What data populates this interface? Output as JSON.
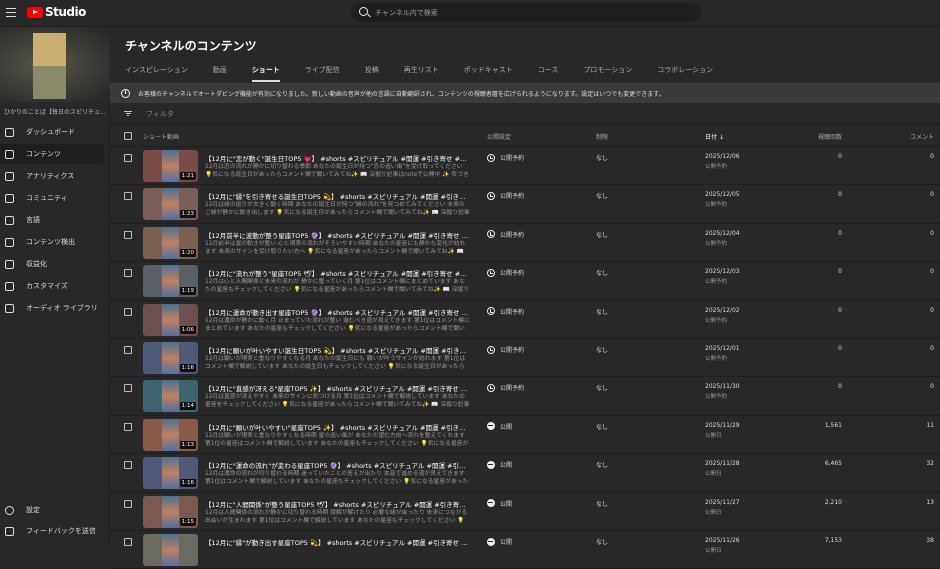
{
  "header": {
    "app": "Studio",
    "search_placeholder": "チャンネル内で検索"
  },
  "sidebar": {
    "channel_name": "ひかりのことば【毎日のスピリチュ...",
    "items": [
      {
        "label": "ダッシュボード",
        "icon": "dashboard-icon"
      },
      {
        "label": "コンテンツ",
        "icon": "content-icon",
        "active": true
      },
      {
        "label": "アナリティクス",
        "icon": "analytics-icon"
      },
      {
        "label": "コミュニティ",
        "icon": "community-icon"
      },
      {
        "label": "言語",
        "icon": "language-icon"
      },
      {
        "label": "コンテンツ検出",
        "icon": "copyright-icon"
      },
      {
        "label": "収益化",
        "icon": "monetization-icon"
      },
      {
        "label": "カスタマイズ",
        "icon": "customize-icon"
      },
      {
        "label": "オーディオ ライブラリ",
        "icon": "audio-library-icon"
      }
    ],
    "settings": "設定",
    "feedback": "フィードバックを送信"
  },
  "main": {
    "title": "チャンネルのコンテンツ",
    "tabs": [
      "インスピレーション",
      "動画",
      "ショート",
      "ライブ配信",
      "投稿",
      "再生リスト",
      "ポッドキャスト",
      "コース",
      "プロモーション",
      "コラボレーション"
    ],
    "active_tab": "ショート",
    "banner": "お客様のチャンネルでオートダビング機能が有効になりました。新しい動画の音声が他の言語に自動翻訳され、コンテンツの視聴者層を広げられるようになります。設定はいつでも変更できます。",
    "filter_placeholder": "フィルタ",
    "columns": {
      "video": "ショート動画",
      "visibility": "公開設定",
      "restrictions": "制限",
      "date": "日付",
      "views": "視聴回数",
      "comments": "コメント"
    },
    "rows": [
      {
        "title": "【12月に\"恋が動く\"誕生日TOP5 💗】 #shorts #スピリチュアル #開運 #引き寄せ #潜在意識 #恋愛...",
        "desc": "12月は恋の流れが静かに切り替わる季節 あなたの誕生日が持つ\"恋の追い風\"を受け取ってください 💡気になる誕生日があったらコメント欄で聞いてみてね✨ 📖 深掘り記事はnoteで公開中 ✨ 気づきや体験談...",
        "duration": "1:21",
        "visibility": "公開予約",
        "restriction": "なし",
        "date": "2025/12/06",
        "date_sub": "公開予約",
        "views": "0",
        "comments": "0",
        "color": "#7a4a48"
      },
      {
        "title": "【12月に\"縁\"を引き寄せる誕生日TOP5 💫】 #shorts #スピリチュアル #開運 #引き寄せ #潜在意識...",
        "desc": "12月は縁の巡りが大きく動く時期 あなたの誕生日が持つ\"縁の流れ\"を見つめてみてください 未来のご縁が静かに動き出します 💡気になる誕生日があったらコメント欄で聞いてみてね✨ 📖 深掘り記事はnoteで...",
        "duration": "1:23",
        "visibility": "公開予約",
        "restriction": "なし",
        "date": "2025/12/05",
        "date_sub": "公開予約",
        "views": "0",
        "comments": "0",
        "color": "#7a5e5a"
      },
      {
        "title": "【12月前半に波動が整う星座TOP5 🔮】 #shorts #スピリチュアル #開運 #引き寄せ #潜在意識 #...",
        "desc": "12月前半は星の動きが整い 心と現実の流れがそろいやすい時期 あなたの星座にも静かな変化が訪れます 未来のサインを受け取りたい方へ 💡気になる星座があったらコメント欄で聞いてみてね✨ 📖 深掘り記...",
        "duration": "1:20",
        "visibility": "公開予約",
        "restriction": "なし",
        "date": "2025/12/04",
        "date_sub": "公開予約",
        "views": "0",
        "comments": "0",
        "color": "#7a6050"
      },
      {
        "title": "【12月に\"流れが整う\"星座TOP5 🕊】 #shorts #スピリチュアル #開運 #引き寄せ #潜在意識 #...",
        "desc": "12月は心と人間関係と未来の流れが 静かに整っていく月 第1位はコメント欄にまとめています あなたの星座もチェックしてください 💡気になる星座があったらコメント欄で聞いてみてね✨ 📖 深掘り記事はnot...",
        "duration": "1:19",
        "visibility": "公開予約",
        "restriction": "なし",
        "date": "2025/12/03",
        "date_sub": "公開予約",
        "views": "0",
        "comments": "0",
        "color": "#5a6068"
      },
      {
        "title": "【12月に運命が動き出す星座TOP5 🔮】 #shorts #スピリチュアル #開運 #引き寄せ #潜在意識 #...",
        "desc": "12月は運命が静かに動く月 止まっていた流れが整い 進むべき道が見えてきます 第1位はコメント欄にまとめています あなたの星座もチェックしてください 💡気になる星座があったらコメント欄で聞いてみてね...",
        "duration": "1:06",
        "visibility": "公開予約",
        "restriction": "なし",
        "date": "2025/12/02",
        "date_sub": "公開予約",
        "views": "0",
        "comments": "0",
        "color": "#6e5050"
      },
      {
        "title": "【12月に願いが叶いやすい誕生日TOP5 💫】 #shorts #スピリチュアル #開運 #引き寄せ #潜在意...",
        "desc": "12月は願いが現実と重なりやすくなる月 あなたの誕生日にも 願いが叶うサインが訪れます 第1位はコメント欄で解説しています あなたの誕生日もチェックしてください 💡気になる誕生日があったらコメント欄...",
        "duration": "1:16",
        "visibility": "公開予約",
        "restriction": "なし",
        "date": "2025/12/01",
        "date_sub": "公開予約",
        "views": "0",
        "comments": "0",
        "color": "#4e5a78"
      },
      {
        "title": "【12月に\"直感が冴える\"星座TOP5 ✨】 #shorts #スピリチュアル #開運 #引き寄せ #潜在意識 #星...",
        "desc": "12月は直感が冴えやすく 未来のサインに気づける月 第1位はコメント欄で解説しています あなたの星座をチェックしてください 💡気になる星座があったらコメント欄で聞いてみてね✨ 📖 深掘り記事はnoteで...",
        "duration": "1:14",
        "visibility": "公開予約",
        "restriction": "なし",
        "date": "2025/11/30",
        "date_sub": "公開予約",
        "views": "0",
        "comments": "0",
        "color": "#3e6470"
      },
      {
        "title": "【12月に\"願いが叶いやすい\"星座TOP5 ✨】 #shorts #スピリチュアル #開運 #引き寄せ #潜在...",
        "desc": "12月は願いが現実と重なりやすくなる時期 星の追い風が あなたの望む方向へ流れを整えてくれます 第1位の星座はコメント欄で解説しています あなたの星座もチェックしてください 💡気になる星座があったら...",
        "duration": "1:13",
        "visibility": "公開",
        "restriction": "なし",
        "date": "2025/11/29",
        "date_sub": "公開日",
        "views": "1,561",
        "comments": "11",
        "color": "#8a5a48"
      },
      {
        "title": "【12月に\"運命の流れ\"が変わる星座TOP5 🔮】 #shorts #スピリチュアル #開運 #引き寄せ #潜在...",
        "desc": "12月は運命の流れが切り替わる時期 迷っていたことの答えが出たり 本音で進める道が見えてきます 第1位はコメント欄で解説しています あなたの星座もチェックしてください 💡気になる星座があったらコメン...",
        "duration": "1:16",
        "visibility": "公開",
        "restriction": "なし",
        "date": "2025/11/28",
        "date_sub": "公開日",
        "views": "6,465",
        "comments": "32",
        "color": "#505a78"
      },
      {
        "title": "【12月に\"人間関係\"が整う星座TOP5 🕊】 #shorts #スピリチュアル #開運 #引き寄せ #潜在意識 #...",
        "desc": "12月は人間関係の流れが静かに切り替わる時期 誤解が解けたり 必要な縁が戻ったり 未来につながる出会いが生まれます 第1位はコメント欄で解説しています あなたの星座もチェックしてください 💡気になる...",
        "duration": "1:15",
        "visibility": "公開",
        "restriction": "なし",
        "date": "2025/11/27",
        "date_sub": "公開日",
        "views": "2,210",
        "comments": "13",
        "color": "#7a5a50"
      },
      {
        "title": "【12月に\"縁\"が動き出す星座TOP5 💫】 #shorts #スピリチュアル #開運 #引き寄せ #潜在意識 #星...",
        "desc": "",
        "duration": "",
        "visibility": "公開",
        "restriction": "なし",
        "date": "2025/11/26",
        "date_sub": "公開日",
        "views": "7,153",
        "comments": "38",
        "color": "#6a6a60"
      }
    ]
  }
}
